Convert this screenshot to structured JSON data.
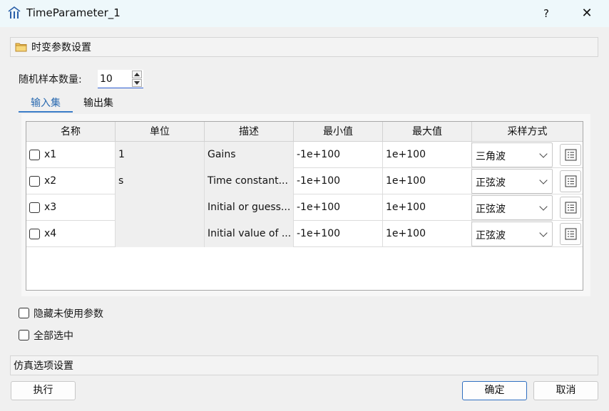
{
  "window": {
    "title": "TimeParameter_1",
    "help_label": "?",
    "close_label": "✕"
  },
  "section_timevarying": {
    "label": "时变参数设置"
  },
  "sample_count": {
    "label": "随机样本数量:",
    "value": "10"
  },
  "tabs": [
    {
      "label": "输入集",
      "active": true
    },
    {
      "label": "输出集",
      "active": false
    }
  ],
  "table": {
    "headers": [
      "名称",
      "单位",
      "描述",
      "最小值",
      "最大值",
      "采样方式"
    ],
    "rows": [
      {
        "name": "x1",
        "unit": "1",
        "desc": "Gains",
        "min": "-1e+100",
        "max": "1e+100",
        "sampling": "三角波"
      },
      {
        "name": "x2",
        "unit": "s",
        "desc": "Time constant...",
        "min": "-1e+100",
        "max": "1e+100",
        "sampling": "正弦波"
      },
      {
        "name": "x3",
        "unit": "",
        "desc": "Initial or guess...",
        "min": "-1e+100",
        "max": "1e+100",
        "sampling": "正弦波"
      },
      {
        "name": "x4",
        "unit": "",
        "desc": "Initial value of ...",
        "min": "-1e+100",
        "max": "1e+100",
        "sampling": "正弦波"
      }
    ]
  },
  "options": {
    "hide_unused": "隐藏未使用参数",
    "select_all": "全部选中"
  },
  "section_sim": {
    "label": "仿真选项设置"
  },
  "buttons": {
    "execute": "执行",
    "ok": "确定",
    "cancel": "取消"
  },
  "colors": {
    "accent": "#3b7dc8",
    "title_bg": "#eef8fb",
    "folder": "#e8b84a"
  },
  "icons": {
    "app": "building-columns-icon",
    "folder": "folder-icon",
    "list": "list-icon",
    "chevron": "chevron-down-icon"
  }
}
